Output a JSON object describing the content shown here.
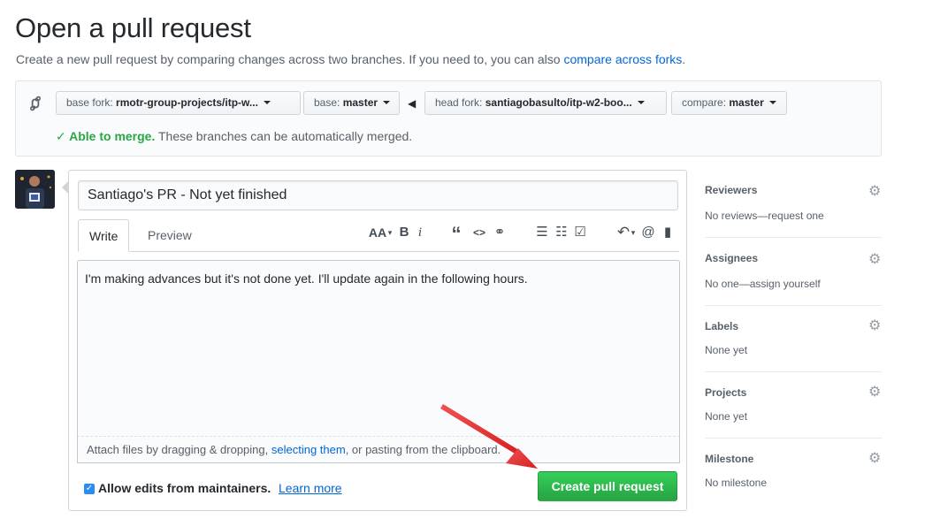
{
  "page": {
    "title": "Open a pull request",
    "subtitle": "Create a new pull request by comparing changes across two branches. If you need to, you can also ",
    "subtitle_link": "compare across forks",
    "subtitle_end": "."
  },
  "range": {
    "base_fork_label": "base fork:",
    "base_fork_value": "rmotr-group-projects/itp-w...",
    "base_label": "base:",
    "base_value": "master",
    "head_fork_label": "head fork:",
    "head_fork_value": "santiagobasulto/itp-w2-boo...",
    "compare_label": "compare:",
    "compare_value": "master",
    "merge_status": "Able to merge.",
    "merge_text": " These branches can be automatically merged."
  },
  "form": {
    "title_value": "Santiago's PR - Not yet finished",
    "tab_write": "Write",
    "tab_preview": "Preview",
    "body_text": "I'm making advances but it's not done yet. I'll update again in the following hours.",
    "attach_prefix": "Attach files by dragging & dropping, ",
    "attach_link": "selecting them",
    "attach_suffix": ", or pasting from the clipboard.",
    "allow_edits": "Allow edits from maintainers.",
    "learn_more": "Learn more",
    "create_button": "Create pull request"
  },
  "toolbar": {
    "header": "AA",
    "bold": "B",
    "italic": "i",
    "quote": "“",
    "code": "<>",
    "link": "⚭",
    "ul": "☰",
    "ol": "☷",
    "tasks": "☑",
    "reply": "↶",
    "mention": "@",
    "saved": "▮"
  },
  "sidebar": [
    {
      "heading": "Reviewers",
      "value": "No reviews—request one"
    },
    {
      "heading": "Assignees",
      "value": "No one—assign yourself"
    },
    {
      "heading": "Labels",
      "value": "None yet"
    },
    {
      "heading": "Projects",
      "value": "None yet"
    },
    {
      "heading": "Milestone",
      "value": "No milestone"
    }
  ],
  "colors": {
    "accent_link": "#0366d6",
    "success": "#28a745",
    "annotation_arrow": "#e02424"
  }
}
